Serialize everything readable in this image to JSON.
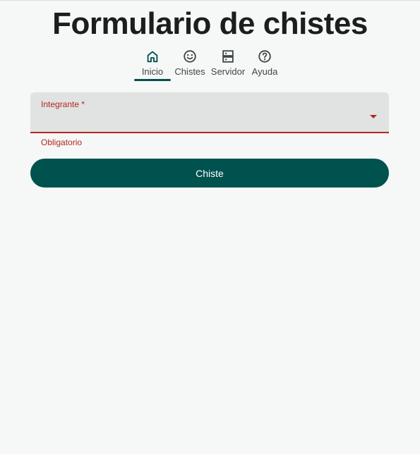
{
  "header": {
    "title": "Formulario de chistes"
  },
  "nav": {
    "tabs": [
      {
        "label": "Inicio",
        "icon": "home-icon",
        "active": true
      },
      {
        "label": "Chistes",
        "icon": "smiley-face-icon",
        "active": false
      },
      {
        "label": "Servidor",
        "icon": "server-icon",
        "active": false
      },
      {
        "label": "Ayuda",
        "icon": "help-circle-icon",
        "active": false
      }
    ]
  },
  "form": {
    "select": {
      "label": "Integrante *",
      "value": "",
      "error": "Obligatorio"
    },
    "submit_label": "Chiste"
  },
  "colors": {
    "primary": "#00524f",
    "error": "#b3261e",
    "background": "#f6f8f7",
    "field_background": "#e1e3e2"
  }
}
